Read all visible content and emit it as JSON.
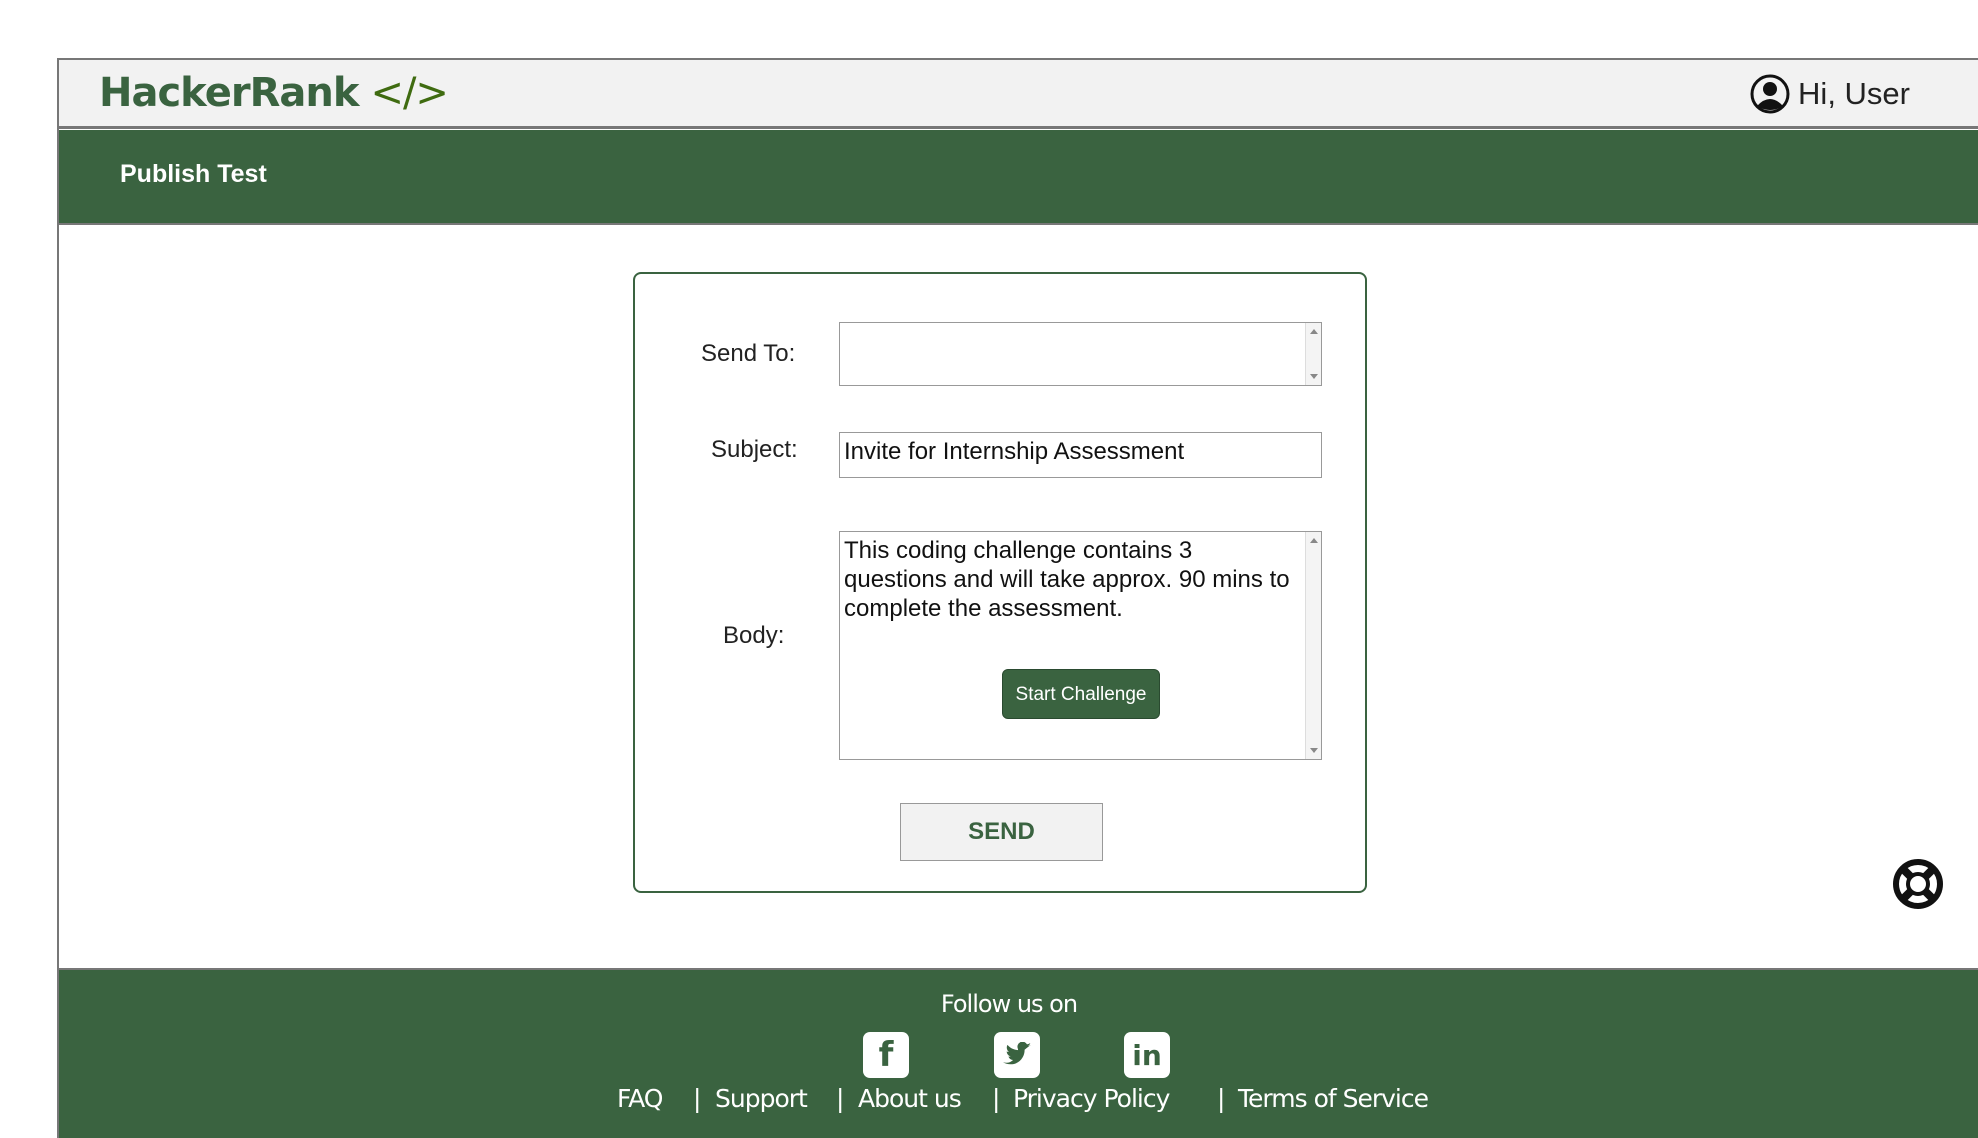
{
  "header": {
    "logo": "HackerRank",
    "logo_code": "</>",
    "greeting": "Hi, User"
  },
  "page": {
    "title": "Publish Test"
  },
  "form": {
    "send_to_label": "Send To:",
    "send_to_value": "",
    "subject_label": "Subject:",
    "subject_value": "Invite for Internship Assessment",
    "body_label": "Body:",
    "body_text": "This coding challenge contains 3 questions and will take approx. 90 mins to complete the assessment.",
    "start_button": "Start Challenge",
    "send_button": "SEND"
  },
  "footer": {
    "follow": "Follow us on",
    "social": [
      "facebook-icon",
      "twitter-icon",
      "linkedin-icon"
    ],
    "links": [
      "FAQ",
      "Support",
      "About us",
      "Privacy Policy",
      "Terms of Service"
    ],
    "separator": "|"
  },
  "colors": {
    "brand_green": "#3a6340",
    "logo_code_green": "#3f6b10"
  }
}
